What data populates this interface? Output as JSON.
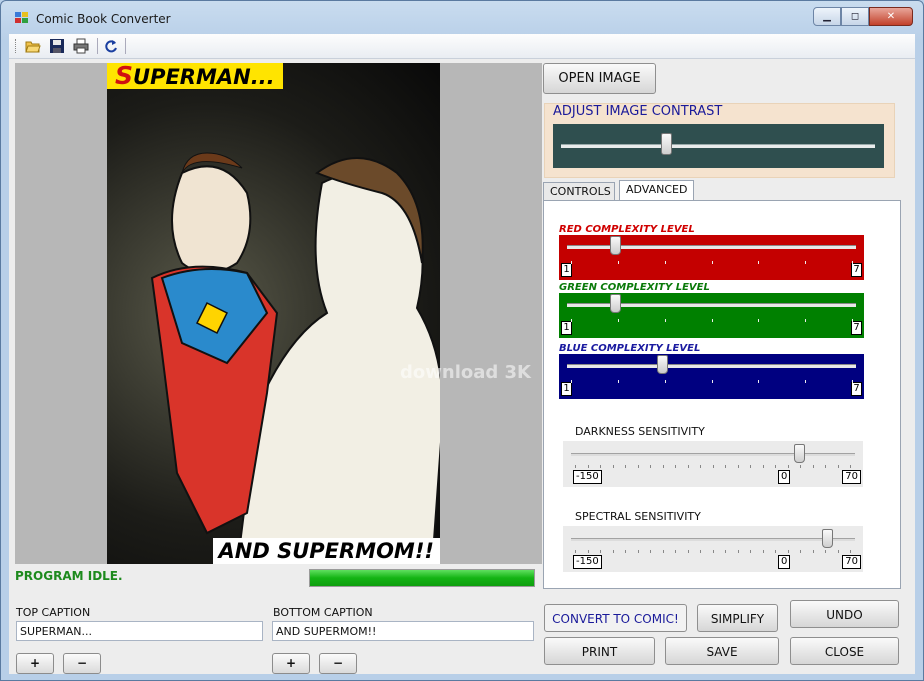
{
  "window": {
    "title": "Comic Book Converter",
    "min_label": "▁",
    "max_label": "◻",
    "close_label": "✕"
  },
  "toolbar": {
    "icons": [
      "open-folder-icon",
      "save-disk-icon",
      "print-icon",
      "refresh-icon"
    ]
  },
  "image": {
    "top_caption_text": "SUPERMAN...",
    "top_caption_first": "S",
    "top_caption_rest": "UPERMAN...",
    "bottom_caption_text": "AND SUPERMOM!!",
    "watermark": "download 3K"
  },
  "status": {
    "text": "PROGRAM IDLE.",
    "progress": 1.0,
    "color": "#1d8a1d"
  },
  "captions": {
    "top_label": "TOP CAPTION",
    "top_value": "SUPERMAN...",
    "bottom_label": "BOTTOM CAPTION",
    "bottom_value": "AND SUPERMOM!!",
    "plus": "+",
    "minus": "−"
  },
  "buttons": {
    "open_image": "OPEN IMAGE",
    "convert": "CONVERT TO COMIC!",
    "simplify": "SIMPLIFY",
    "undo": "UNDO",
    "print": "PRINT",
    "save": "SAVE",
    "close": "CLOSE"
  },
  "contrast": {
    "header": "ADJUST IMAGE CONTRAST",
    "value_fraction": 0.33,
    "bg": "#2f4f4f"
  },
  "tabs": {
    "controls": "CONTROLS",
    "advanced": "ADVANCED",
    "active": "advanced"
  },
  "complexity": [
    {
      "name": "RED COMPLEXITY LEVEL",
      "color": "#c40000",
      "label_color": "#d00000",
      "min": "1",
      "max": "7",
      "value": 2
    },
    {
      "name": "GREEN COMPLEXITY LEVEL",
      "color": "#008000",
      "label_color": "#0a7a0a",
      "min": "1",
      "max": "7",
      "value": 2
    },
    {
      "name": "BLUE COMPLEXITY LEVEL",
      "color": "#000080",
      "label_color": "#1a1aa0",
      "min": "1",
      "max": "7",
      "value": 3
    }
  ],
  "sensitivity": [
    {
      "name": "DARKNESS SENSITIVITY",
      "min": "-150",
      "mid": "0",
      "max": "70",
      "value_fraction": 0.81
    },
    {
      "name": "SPECTRAL SENSITIVITY",
      "min": "-150",
      "mid": "0",
      "max": "70",
      "value_fraction": 0.91
    }
  ]
}
